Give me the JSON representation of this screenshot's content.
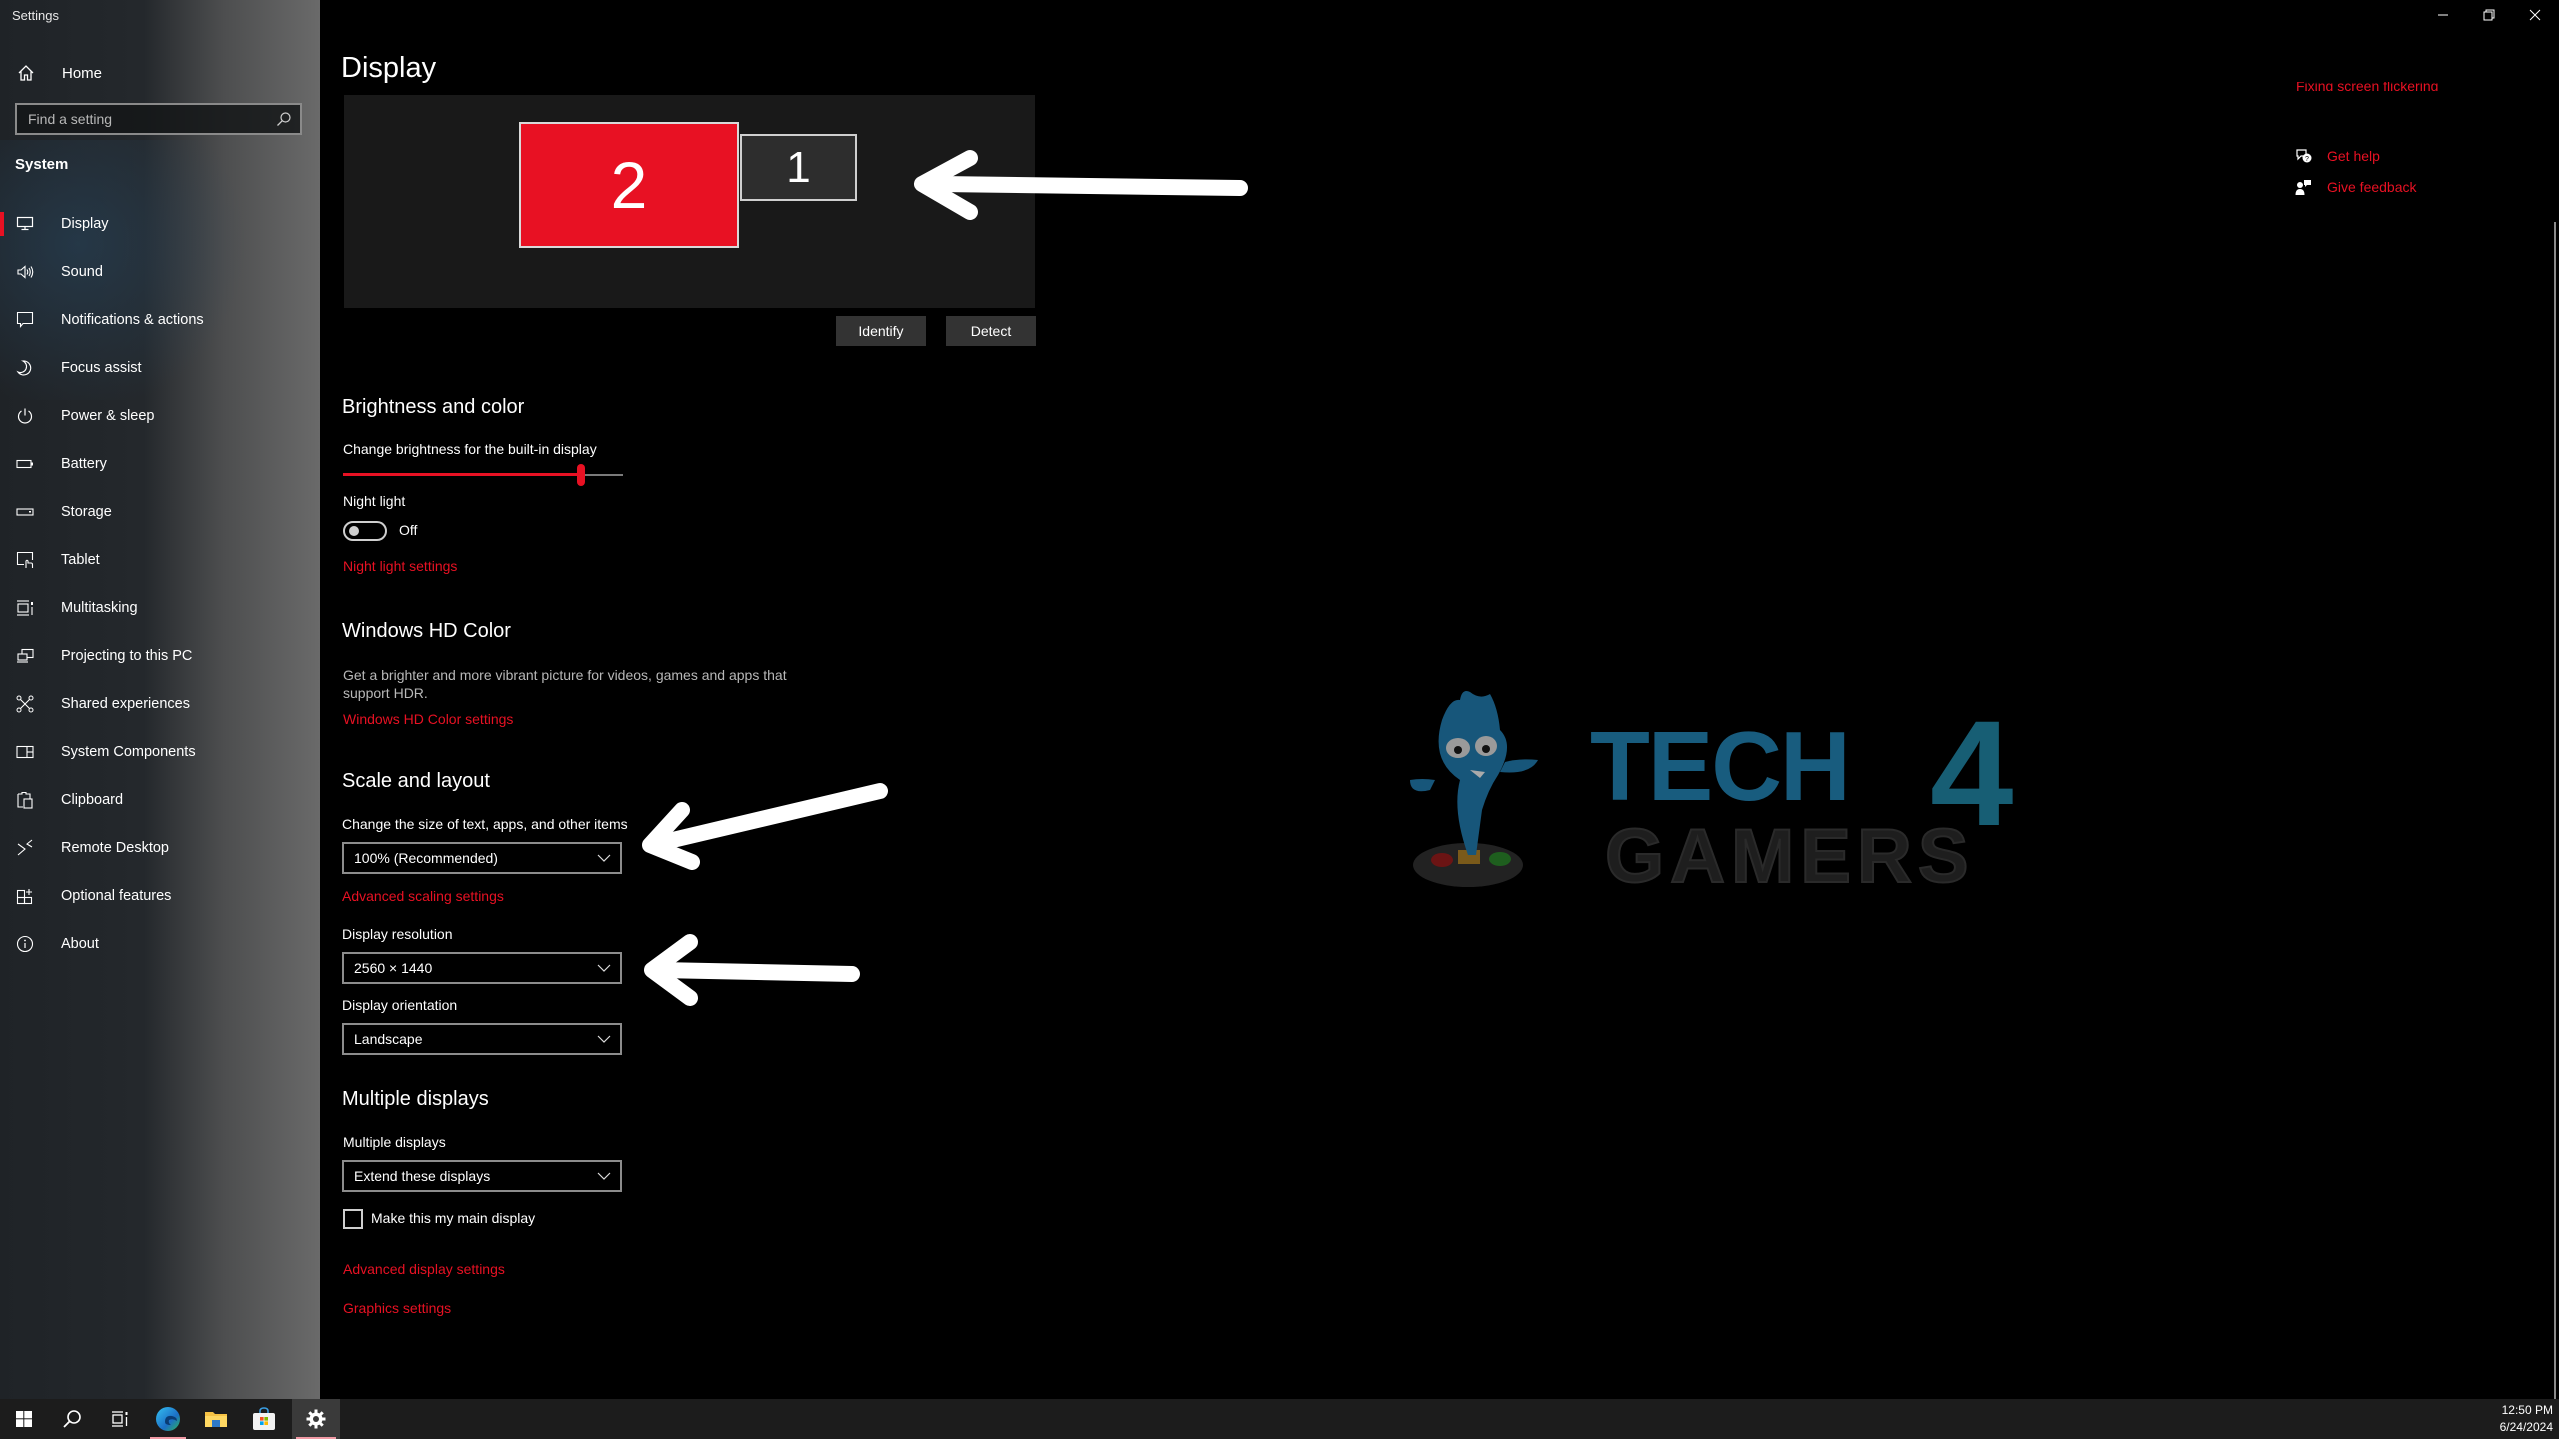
{
  "window": {
    "title": "Settings",
    "caption_buttons": [
      "minimize",
      "restore",
      "close"
    ]
  },
  "sidebar": {
    "home_label": "Home",
    "search_placeholder": "Find a setting",
    "section_label": "System",
    "active_item": "Display",
    "items": [
      {
        "label": "Display",
        "icon": "monitor-icon"
      },
      {
        "label": "Sound",
        "icon": "speaker-icon"
      },
      {
        "label": "Notifications & actions",
        "icon": "message-icon"
      },
      {
        "label": "Focus assist",
        "icon": "moon-icon"
      },
      {
        "label": "Power & sleep",
        "icon": "power-icon"
      },
      {
        "label": "Battery",
        "icon": "battery-icon"
      },
      {
        "label": "Storage",
        "icon": "storage-icon"
      },
      {
        "label": "Tablet",
        "icon": "tablet-icon"
      },
      {
        "label": "Multitasking",
        "icon": "multitasking-icon"
      },
      {
        "label": "Projecting to this PC",
        "icon": "projecting-icon"
      },
      {
        "label": "Shared experiences",
        "icon": "shared-icon"
      },
      {
        "label": "System Components",
        "icon": "components-icon"
      },
      {
        "label": "Clipboard",
        "icon": "clipboard-icon"
      },
      {
        "label": "Remote Desktop",
        "icon": "remote-icon"
      },
      {
        "label": "Optional features",
        "icon": "optional-icon"
      },
      {
        "label": "About",
        "icon": "info-icon"
      }
    ]
  },
  "main": {
    "title": "Display",
    "arrangement": {
      "monitors": [
        {
          "label": "2",
          "selected": true
        },
        {
          "label": "1",
          "selected": false
        }
      ],
      "identify_label": "Identify",
      "detect_label": "Detect"
    },
    "brightness": {
      "heading": "Brightness and color",
      "slider_label": "Change brightness for the built-in display",
      "slider_value_percent": 85,
      "night_light_label": "Night light",
      "night_light_state": "Off",
      "night_light_link": "Night light settings"
    },
    "hd_color": {
      "heading": "Windows HD Color",
      "description": "Get a brighter and more vibrant picture for videos, games and apps that support HDR.",
      "link": "Windows HD Color settings"
    },
    "scale": {
      "heading": "Scale and layout",
      "size_label": "Change the size of text, apps, and other items",
      "size_value": "100% (Recommended)",
      "advanced_link": "Advanced scaling settings",
      "resolution_label": "Display resolution",
      "resolution_value": "2560 × 1440",
      "orientation_label": "Display orientation",
      "orientation_value": "Landscape"
    },
    "multiple": {
      "heading": "Multiple displays",
      "label": "Multiple displays",
      "value": "Extend these displays",
      "checkbox_label": "Make this my main display",
      "checkbox_checked": false,
      "advanced_link": "Advanced display settings",
      "graphics_link": "Graphics settings"
    }
  },
  "right_pane": {
    "cut_link": "Fixing screen flickering",
    "get_help": "Get help",
    "give_feedback": "Give feedback"
  },
  "watermark": {
    "line1": "TECH",
    "digit": "4",
    "line2": "GAMERS"
  },
  "taskbar": {
    "items": [
      "start",
      "search",
      "task-view",
      "edge",
      "file-explorer",
      "store",
      "settings"
    ],
    "time": "12:50 PM",
    "date": "6/24/2024"
  },
  "colors": {
    "accent": "#e81123",
    "background": "#000000",
    "panel": "#191919",
    "watermark_blue": "#1a5f82"
  }
}
